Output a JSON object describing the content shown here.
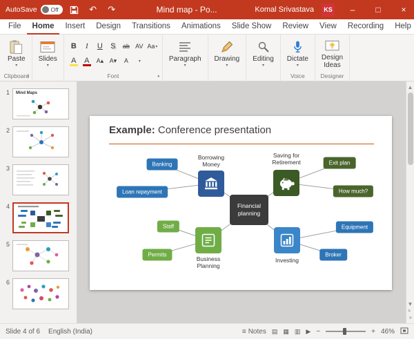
{
  "titlebar": {
    "autosave_label": "AutoSave",
    "autosave_state": "Off",
    "document_title": "Mind map  -  Po...",
    "user_name": "Komal Srivastava",
    "user_initials": "KS"
  },
  "menubar": {
    "tabs": [
      "File",
      "Home",
      "Insert",
      "Design",
      "Transitions",
      "Animations",
      "Slide Show",
      "Review",
      "View",
      "Recording",
      "Help"
    ],
    "active_tab": "Home"
  },
  "ribbon": {
    "paste_label": "Paste",
    "slides_label": "Slides",
    "paragraph_label": "Paragraph",
    "drawing_label": "Drawing",
    "editing_label": "Editing",
    "dictate_label": "Dictate",
    "design_ideas_label": "Design\nIdeas",
    "group_clipboard": "Clipboard",
    "group_font": "Font",
    "group_voice": "Voice",
    "group_designer": "Designer"
  },
  "glyphs": {
    "undo": "↶",
    "redo": "↷",
    "minimize": "–",
    "maximize": "□",
    "close": "×",
    "caret": "▾",
    "bold": "B",
    "italic": "I",
    "underline": "U",
    "shadow": "S",
    "strikethrough": "ab",
    "char_spacing": "AV",
    "change_case": "Aa",
    "highlight": "A",
    "font_color": "A",
    "size_up": "A▴",
    "size_down": "A▾",
    "clear_format": "A",
    "notes": "≡",
    "scroll_up": "▲",
    "scroll_down": "▼",
    "double_chevron": "«",
    "zoom_out": "−",
    "zoom_in": "+",
    "view_normal": "▤",
    "view_sorter": "▦",
    "view_reading": "▥",
    "view_slideshow": "▶"
  },
  "slides_panel": {
    "numbers": [
      "1",
      "2",
      "3",
      "4",
      "5",
      "6"
    ],
    "selected": "4",
    "thumb1_title": "Mind Maps"
  },
  "slide": {
    "title_lead": "Example:",
    "title_rest": " Conference presentation",
    "center": "Financial\nplanning",
    "branches": [
      {
        "label": "Borrowing\nMoney",
        "nodes": [
          "Banking",
          "Loan repayment"
        ]
      },
      {
        "label": "Saving for\nRetirement",
        "nodes": [
          "Exit plan",
          "How much?"
        ]
      },
      {
        "label": "Business\nPlanning",
        "nodes": [
          "Staff",
          "Permits"
        ]
      },
      {
        "label": "Investing",
        "nodes": [
          "Equipment",
          "Broker"
        ]
      }
    ]
  },
  "statusbar": {
    "slide_indicator": "Slide 4 of 6",
    "language": "English (India)",
    "notes_label": "Notes",
    "zoom_percent": "46%"
  },
  "colors": {
    "titlebar_red": "#C2391F",
    "accent_red": "#C2391F",
    "node_blue": "#2E75B6",
    "bank_blue": "#2F5B9B",
    "invest_blue": "#3A86C8",
    "dark_green": "#3C5A26",
    "dark_green_node": "#4A652C",
    "light_green": "#70AD47",
    "center_gray": "#3B3B3B",
    "divider_orange": "#C55A11"
  }
}
